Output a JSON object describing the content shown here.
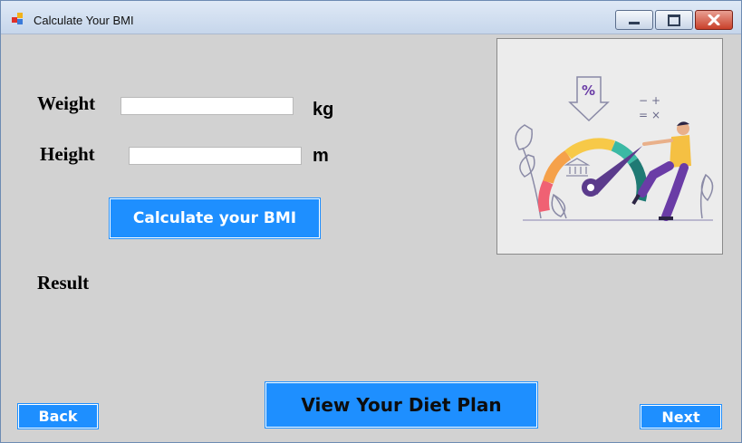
{
  "window": {
    "title": "Calculate Your BMI"
  },
  "form": {
    "weight_label": "Weight",
    "weight_value": "",
    "weight_unit": "kg",
    "height_label": "Height",
    "height_value": "",
    "height_unit": "m",
    "calculate_label": "Calculate your BMI",
    "result_label": "Result"
  },
  "footer": {
    "back_label": "Back",
    "diet_label": "View Your Diet Plan",
    "next_label": "Next"
  },
  "illustration": {
    "sign_text": "%",
    "icon": "bmi-gauge-illustration"
  },
  "colors": {
    "button_blue": "#1e8fff",
    "form_background": "#d2d2d2",
    "close_red": "#c9402a"
  }
}
